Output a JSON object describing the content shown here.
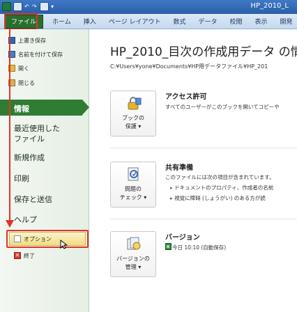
{
  "window": {
    "title": "HP_2010_L"
  },
  "ribbon": {
    "tabs": [
      "ファイル",
      "ホーム",
      "挿入",
      "ページ レイアウト",
      "数式",
      "データ",
      "校閲",
      "表示",
      "開発"
    ]
  },
  "backstage": {
    "commands": {
      "save": "上書き保存",
      "save_as": "名前を付けて保存",
      "open": "開く",
      "close": "閉じる"
    },
    "nav": {
      "info": "情報",
      "recent_line1": "最近使用した",
      "recent_line2": "ファイル",
      "new": "新規作成",
      "print": "印刷",
      "save_send": "保存と送信",
      "help": "ヘルプ"
    },
    "bottom_commands": {
      "options": "オプション",
      "exit": "終了"
    }
  },
  "info": {
    "title": "HP_2010_目次の作成用データ の情",
    "path": "C:¥Users¥yone¥Documents¥HP用データファイル¥HP_201",
    "permissions": {
      "button_line1": "ブックの",
      "button_line2": "保護 ▾",
      "heading": "アクセス許可",
      "description": "すべてのユーザーがこのブックを開いてコピーや"
    },
    "prepare": {
      "button_line1": "問題の",
      "button_line2": "チェック ▾",
      "heading": "共有準備",
      "description": "このファイルには次の項目が含まれています。",
      "bullets": [
        "ドキュメントのプロパティ、作成者の名前",
        "視覚に障碍 (しょうがい) のある方が読"
      ]
    },
    "versions": {
      "button_line1": "バージョンの",
      "button_line2": "管理 ▾",
      "heading": "バージョン",
      "entry": "今日 10:10 (自動保存)"
    }
  },
  "colors": {
    "nav_active": "#2e7d32",
    "highlight": "#e0342a",
    "title_bar": "#2a5ea8"
  }
}
